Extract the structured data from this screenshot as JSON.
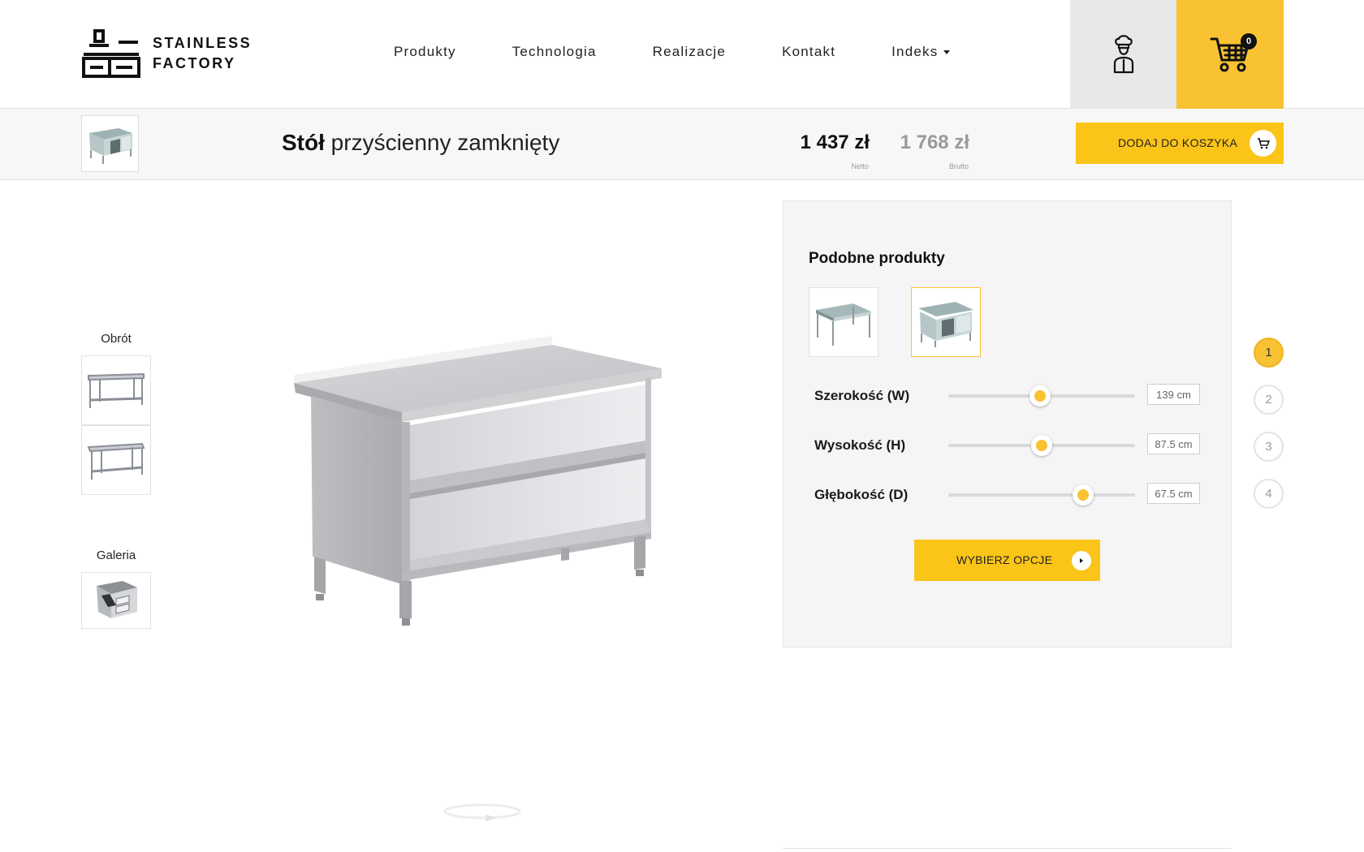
{
  "header": {
    "logo": {
      "line1": "STAINLESS",
      "line2": "FACTORY"
    },
    "nav": [
      {
        "label": "Produkty"
      },
      {
        "label": "Technologia"
      },
      {
        "label": "Realizacje"
      },
      {
        "label": "Kontakt"
      },
      {
        "label": "Indeks",
        "has_dropdown": true
      }
    ],
    "account_icon": "chef-icon",
    "cart": {
      "icon": "cart-icon",
      "count": "0"
    }
  },
  "product_bar": {
    "title_bold": "Stół",
    "title_rest": "przyścienny zamknięty",
    "price_net": "1 437 zł",
    "price_net_label": "Netto",
    "price_gross": "1 768 zł",
    "price_gross_label": "Brutto",
    "add_to_cart_label": "DODAJ DO KOSZYKA"
  },
  "side": {
    "rotation_heading": "Obrót",
    "gallery_heading": "Galeria"
  },
  "panel": {
    "heading": "Podobne produkty",
    "dimensions": [
      {
        "label": "Szerokość (W)",
        "value": "139 cm",
        "slider_fraction": 0.49
      },
      {
        "label": "Wysokość (H)",
        "value": "87.5 cm",
        "slider_fraction": 0.5
      },
      {
        "label": "Głębokość (D)",
        "value": "67.5 cm",
        "slider_fraction": 0.72
      }
    ],
    "options_button_label": "WYBIERZ OPCJE"
  },
  "steps": [
    "1",
    "2",
    "3",
    "4"
  ],
  "active_step": "1",
  "colors": {
    "accent": "#f8c232",
    "button": "#fbc419",
    "header_gray": "#e8e8e8"
  }
}
